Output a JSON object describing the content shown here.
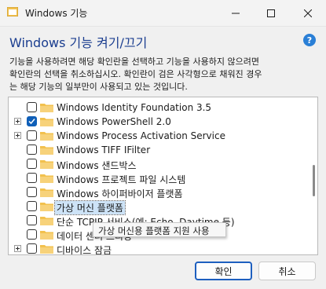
{
  "window": {
    "title": "Windows 기능"
  },
  "header": {
    "heading": "Windows 기능 켜기/끄기",
    "description_lines": [
      "기능을 사용하려면 해당 확인란을 선택하고 기능을 사용하지 않으려면",
      "확인란의 선택을 취소하십시오. 확인란이 검은 사각형으로 채워진 경우",
      "는 해당 기능의 일부만이 사용되고 있는 것입니다."
    ]
  },
  "features": [
    {
      "label": "Windows Identity Foundation 3.5",
      "state": "unchecked",
      "expandable": false,
      "selected": false
    },
    {
      "label": "Windows PowerShell 2.0",
      "state": "checked",
      "expandable": true,
      "selected": false
    },
    {
      "label": "Windows Process Activation Service",
      "state": "unchecked",
      "expandable": true,
      "selected": false
    },
    {
      "label": "Windows TIFF IFilter",
      "state": "unchecked",
      "expandable": false,
      "selected": false
    },
    {
      "label": "Windows 샌드박스",
      "state": "unchecked",
      "expandable": false,
      "selected": false
    },
    {
      "label": "Windows 프로젝트 파일 시스템",
      "state": "unchecked",
      "expandable": false,
      "selected": false
    },
    {
      "label": "Windows 하이퍼바이저 플랫폼",
      "state": "unchecked",
      "expandable": false,
      "selected": false
    },
    {
      "label": "가상 머신 플랫폼",
      "state": "unchecked",
      "expandable": false,
      "selected": true
    },
    {
      "label": "단순 TCPIP 서비스(예: Echo, Daytime 등)",
      "state": "unchecked",
      "expandable": false,
      "selected": false
    },
    {
      "label": "데이터 센터 브리징",
      "state": "unchecked",
      "expandable": false,
      "selected": false
    },
    {
      "label": "디바이스 잠금",
      "state": "unchecked",
      "expandable": true,
      "selected": false
    }
  ],
  "tooltip": {
    "text": "가상 머신용 플랫폼 지원 사용"
  },
  "buttons": {
    "ok": "확인",
    "cancel": "취소"
  },
  "colors": {
    "accent": "#1d5fbf",
    "heading": "#1a3d8f",
    "checkbox_checked": "#0f5fb8",
    "folder": "#f2c14e",
    "selection": "#cde3f7"
  }
}
